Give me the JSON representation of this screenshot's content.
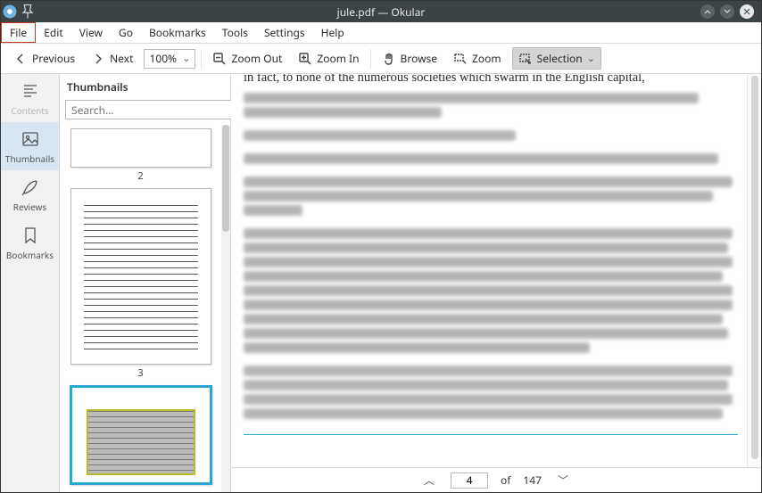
{
  "title": "jule.pdf — Okular",
  "menu": {
    "items": [
      "File",
      "Edit",
      "View",
      "Go",
      "Bookmarks",
      "Tools",
      "Settings",
      "Help"
    ],
    "highlighted": 0
  },
  "toolbar": {
    "prev": "Previous",
    "next": "Next",
    "zoom_value": "100%",
    "zoom_out": "Zoom Out",
    "zoom_in": "Zoom In",
    "browse": "Browse",
    "zoom": "Zoom",
    "selection": "Selection"
  },
  "rail": {
    "contents": "Contents",
    "thumbnails": "Thumbnails",
    "reviews": "Reviews",
    "bookmarks": "Bookmarks",
    "active": "thumbnails"
  },
  "thumbs": {
    "header": "Thumbnails",
    "search_placeholder": "Search...",
    "pages": [
      2,
      3
    ]
  },
  "doc": {
    "first_line": "in fact, to none of the numerous societies which swarm in the English capital,"
  },
  "pagenav": {
    "current": "4",
    "of": "of",
    "total": "147"
  }
}
